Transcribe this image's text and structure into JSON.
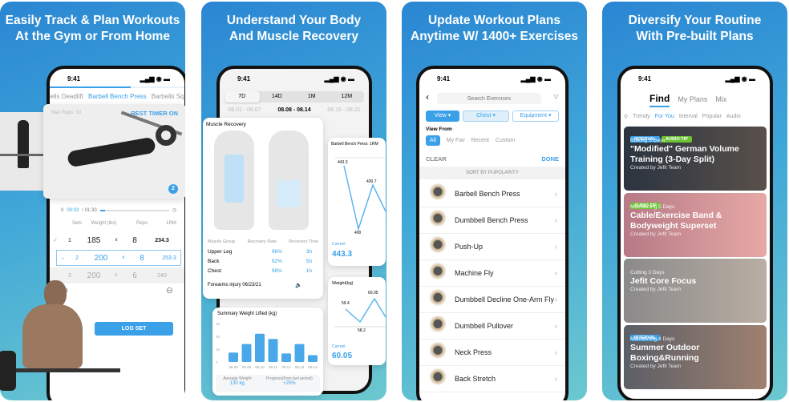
{
  "panels": [
    {
      "title": "Easily Track & Plan Workouts\nAt the Gym or From Home",
      "time": "9:41",
      "exercise_tabs": [
        "bells Deadlift",
        "Barbell Bench Press",
        "Barbells Sq"
      ],
      "max_reps": "Max Reps: 10",
      "rest_timer": "REST TIMER ON",
      "set_badge": "2",
      "timer": {
        "elapsed": "00:03",
        "total": "/ 01:30"
      },
      "columns": [
        "Sets",
        "Weight (lbs)",
        "Reps",
        "1RM"
      ],
      "sets": [
        {
          "set": "1",
          "weight": "185",
          "x": "x",
          "reps": "8",
          "orm": "234.3",
          "mark": "✓"
        },
        {
          "set": "2",
          "weight": "200",
          "x": "x",
          "reps": "8",
          "orm": "253.3",
          "mark": "→"
        },
        {
          "set": "3",
          "weight": "200",
          "x": "x",
          "reps": "6",
          "orm": "240",
          "mark": ""
        }
      ],
      "log_set": "LOG SET"
    },
    {
      "title": "Understand Your Body\nAnd Muscle Recovery",
      "time": "9:41",
      "ranges": [
        "7D",
        "14D",
        "1M",
        "12M"
      ],
      "dates": [
        "08.01 - 08.07",
        "08.08 - 08.14",
        "08.15 - 08.21"
      ],
      "recovery": {
        "title": "Muscle Recovery",
        "headers": [
          "Muscle Group",
          "Recovery Rate",
          "Recovery Time"
        ],
        "rows": [
          {
            "group": "Upper Leg",
            "rate": "96%",
            "time": "3h"
          },
          {
            "group": "Back",
            "rate": "92%",
            "time": "5h"
          },
          {
            "group": "Chest",
            "rate": "98%",
            "time": "1h"
          }
        ],
        "injury": "Forearms injury 06/23/21"
      },
      "bench": {
        "title": "Barbell Bench Press: 1RM",
        "values": [
          "443.3",
          "400",
          "430.7"
        ],
        "current_label": "Current",
        "current": "443.3"
      },
      "weight": {
        "title": "Weight(kg)",
        "values": [
          "59.4",
          "58.2",
          "60.05"
        ],
        "current_label": "Current",
        "current": "60.05"
      },
      "summary": {
        "title": "Summary Weight Lifted (kg)",
        "yticks": [
          "45",
          "30",
          "15",
          "0"
        ],
        "categories": [
          "08.08",
          "08.09",
          "08.10",
          "08.11",
          "08.12",
          "08.13",
          "08.14"
        ],
        "values": [
          11,
          21,
          33,
          27,
          10,
          21,
          8
        ],
        "avg_label": "Average Weight",
        "avg": "130 kg",
        "prog_label": "Progress(from last period)",
        "prog": "+25%"
      }
    },
    {
      "title": "Update Workout Plans\nAnytime W/ 1400+ Exercises",
      "time": "9:41",
      "search_placeholder": "Search Exercises",
      "filters": [
        "View ▾",
        "Chest ▾",
        "Equipment ▾"
      ],
      "view_from": "View From",
      "sources": [
        "All",
        "My Fav",
        "Recent",
        "Custom"
      ],
      "clear": "CLEAR",
      "done": "DONE",
      "sort": "SORT BY PUPOLARITY",
      "exercises": [
        "Barbell Bench Press",
        "Dumbbell Bench Press",
        "Push-Up",
        "Machine Fly",
        "Dumbbell Decline One-Arm Fly",
        "Dumbbell Pullover",
        "Neck Press",
        "Back Stretch"
      ]
    },
    {
      "title": "Diversify Your Routine\nWith Pre-built Plans",
      "time": "9:41",
      "tabs": [
        "Find",
        "My Plans",
        "Mix"
      ],
      "categories": [
        "Trendy",
        "For You",
        "Interval",
        "Popular",
        "Audio"
      ],
      "plans": [
        {
          "tags": [
            "INTERVAL",
            "AUDIO TIP"
          ],
          "meta": "Bulking  5 Days",
          "title": "\"Modified\" German Volume Training (3-Day Split)",
          "by": "Created by Jefit Team"
        },
        {
          "tags": [
            "AUDIO TIP"
          ],
          "meta": "Maintaining  5 Days",
          "title": "Cable/Exercise Band & Bodyweight Superset",
          "by": "Created by Jefit Team"
        },
        {
          "tags": [],
          "meta": "Cutting  3 Days",
          "title": "Jefit Core Focus",
          "by": "Created by Jefit Team"
        },
        {
          "tags": [
            "INTERVAL"
          ],
          "meta": "Maintaining  4 Days",
          "title": "Summer Outdoor Boxing&Running",
          "by": "Created by Jefit Team"
        }
      ]
    }
  ],
  "colors": {
    "accent": "#3aa0e8",
    "interval_tag": "#3aa0e8",
    "audio_tag": "#6cc334"
  }
}
